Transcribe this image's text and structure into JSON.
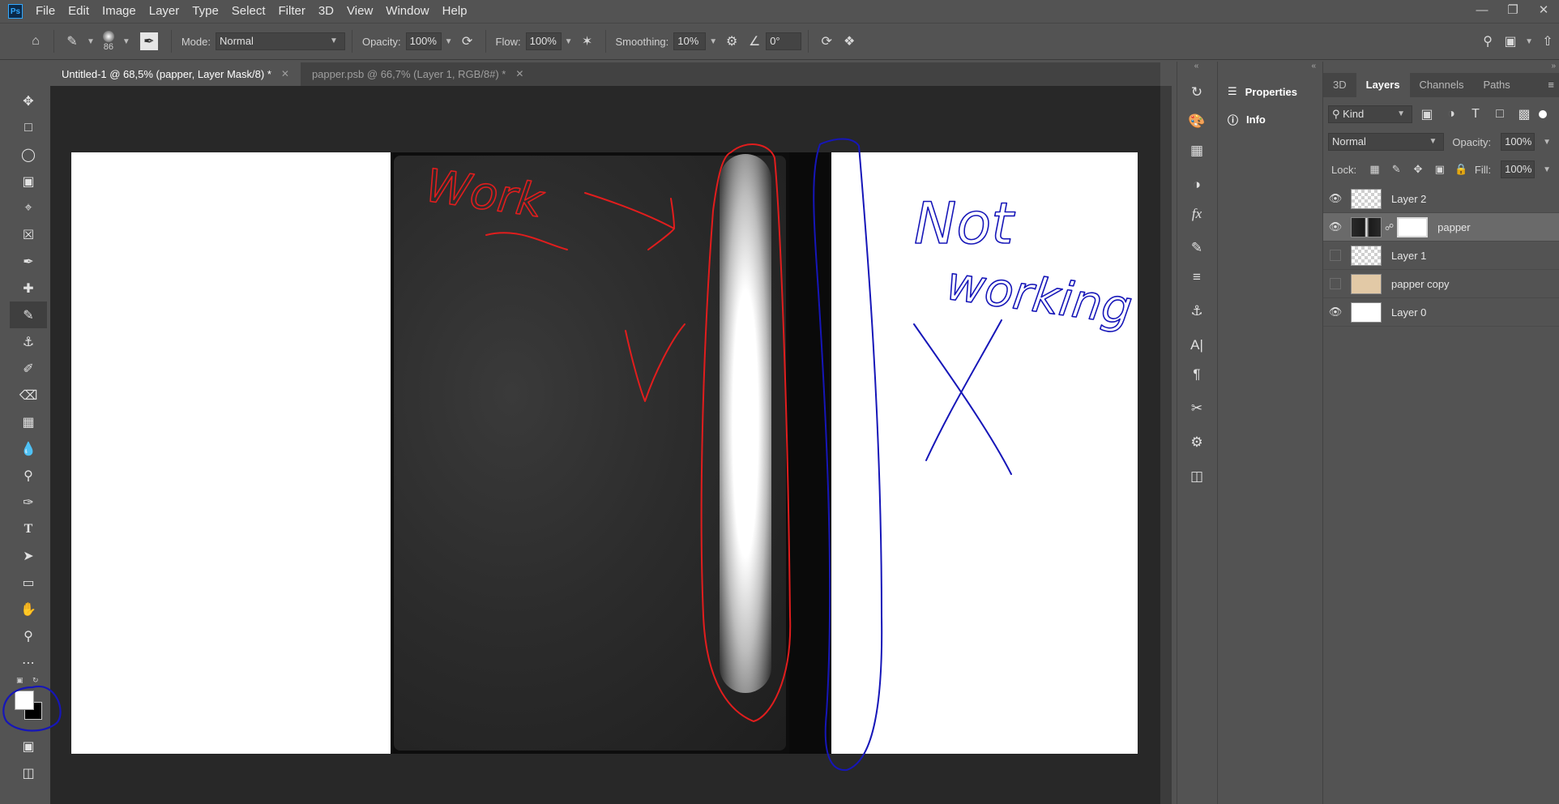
{
  "app": {
    "logo": "Ps"
  },
  "menu": [
    "File",
    "Edit",
    "Image",
    "Layer",
    "Type",
    "Select",
    "Filter",
    "3D",
    "View",
    "Window",
    "Help"
  ],
  "options": {
    "brush_size": "86",
    "mode_label": "Mode:",
    "mode_value": "Normal",
    "opacity_label": "Opacity:",
    "opacity_value": "100%",
    "flow_label": "Flow:",
    "flow_value": "100%",
    "smoothing_label": "Smoothing:",
    "smoothing_value": "10%",
    "angle_value": "0°"
  },
  "tabs": [
    {
      "label": "Untitled-1 @ 68,5% (papper, Layer Mask/8) *",
      "active": true
    },
    {
      "label": "papper.psb @ 66,7% (Layer 1, RGB/8#) *",
      "active": false
    }
  ],
  "annotations": {
    "left_text": "Work",
    "right_text_1": "Not",
    "right_text_2": "working",
    "accent_red": "#e11d1d",
    "accent_blue": "#1616b8"
  },
  "side_panel": {
    "properties": "Properties",
    "info": "Info"
  },
  "layers_panel": {
    "tabs": [
      "3D",
      "Layers",
      "Channels",
      "Paths"
    ],
    "active_tab": "Layers",
    "kind_label": "Kind",
    "blend_mode": "Normal",
    "opacity_label": "Opacity:",
    "opacity_value": "100%",
    "lock_label": "Lock:",
    "fill_label": "Fill:",
    "fill_value": "100%",
    "layers": [
      {
        "name": "Layer 2",
        "visible": true,
        "selected": false
      },
      {
        "name": "papper",
        "visible": true,
        "selected": true,
        "has_mask": true
      },
      {
        "name": "Layer 1",
        "visible": false,
        "selected": false
      },
      {
        "name": "papper copy",
        "visible": false,
        "selected": false
      },
      {
        "name": "Layer 0",
        "visible": true,
        "selected": false
      }
    ]
  }
}
